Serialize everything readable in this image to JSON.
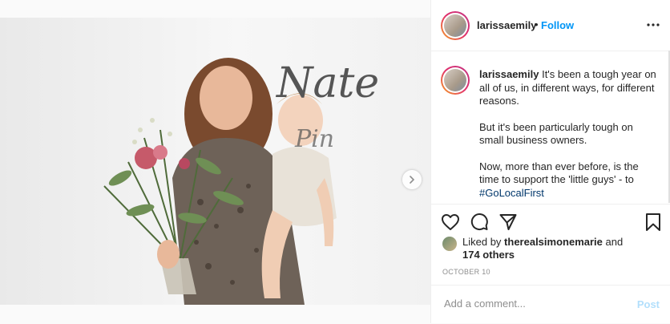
{
  "post": {
    "username": "larissaemily",
    "follow_label": "Follow",
    "bullet": "•",
    "more_icon": "more-horizontal-icon",
    "image": {
      "overlay_text_1": "Nate",
      "overlay_text_2": "Pin",
      "description": "woman with flowers holding baby"
    },
    "caption": {
      "username": "larissaemily",
      "paragraph_1": "It's been a tough year on all of us, in different ways, for different reasons.",
      "paragraph_2": "But it's been particularly tough on small business owners.",
      "paragraph_3_before": "Now, more than ever before, is the time to support the 'little guys' - to ",
      "hashtag": "#GoLocalFirst"
    },
    "likes": {
      "prefix": "Liked by ",
      "user": "therealsimonemarie",
      "middle": " and",
      "count": "174 others"
    },
    "date": "OCTOBER 10",
    "comment": {
      "placeholder": "Add a comment...",
      "post_label": "Post"
    },
    "colors": {
      "accent": "#0095f6",
      "hashtag": "#00376b",
      "muted": "#8e8e8e",
      "post_disabled": "#b2dffc"
    }
  }
}
